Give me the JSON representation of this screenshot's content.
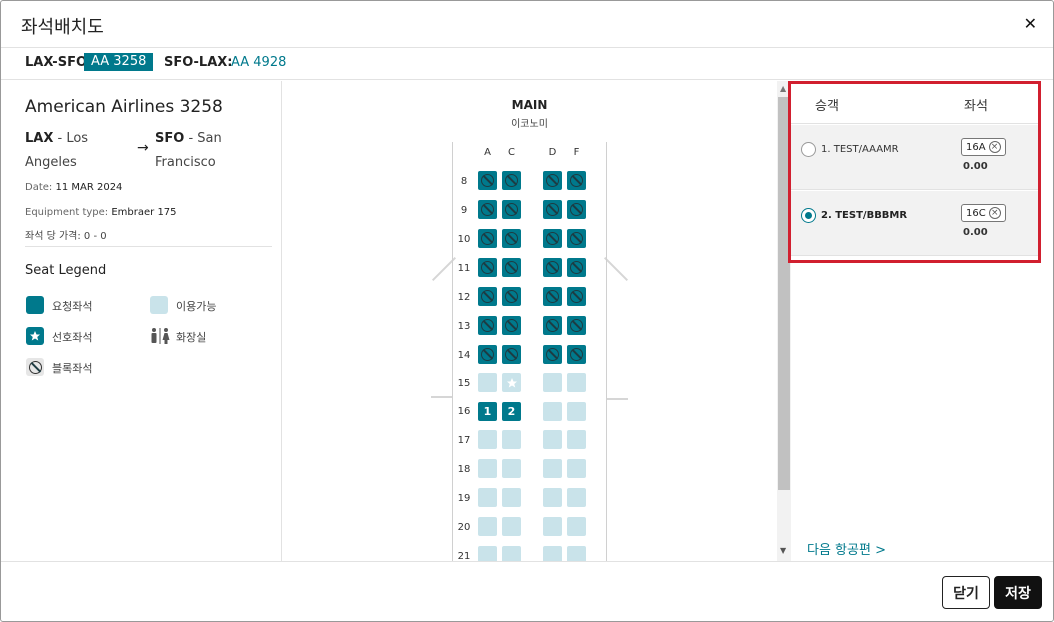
{
  "modal": {
    "title": "좌석배치도"
  },
  "flights": {
    "outbound_label": "LAX-SFO:",
    "outbound_flight": "AA 3258",
    "return_label": "SFO-LAX:",
    "return_flight": "AA 4928"
  },
  "flight_info": {
    "title": "American Airlines 3258",
    "origin_code": "LAX",
    "origin_city_line1": "- Los",
    "origin_city_line2": "Angeles",
    "dest_code": "SFO",
    "dest_city_line1": "- San",
    "dest_city_line2": "Francisco",
    "date_label": "Date:",
    "date_value": "11 MAR 2024",
    "equipment_label": "Equipment type:",
    "equipment_value": "Embraer 175",
    "price_text": "좌석 당 가격: 0 - 0"
  },
  "legend": {
    "title": "Seat Legend",
    "requested": "요청좌석",
    "available": "이용가능",
    "preferred": "선호좌석",
    "restroom": "화장실",
    "blocked": "블록좌석"
  },
  "cabin": {
    "name": "MAIN",
    "class": "이코노미",
    "columns": [
      "A",
      "C",
      "D",
      "F"
    ],
    "rows": [
      "8",
      "9",
      "10",
      "11",
      "12",
      "13",
      "14",
      "15",
      "16",
      "17",
      "18",
      "19",
      "20",
      "21"
    ]
  },
  "passengers": {
    "header_passenger": "승객",
    "header_seat": "좌석",
    "list": [
      {
        "name": "1. TEST/AAAMR",
        "seat": "16A",
        "price": "0.00",
        "selected": false
      },
      {
        "name": "2. TEST/BBBMR",
        "seat": "16C",
        "price": "0.00",
        "selected": true
      }
    ],
    "next_flight": "다음 항공편 >"
  },
  "footer": {
    "close": "닫기",
    "save": "저장"
  },
  "colors": {
    "accent": "#00798c",
    "available": "#c9e3ea",
    "highlight": "#d11f2f"
  }
}
